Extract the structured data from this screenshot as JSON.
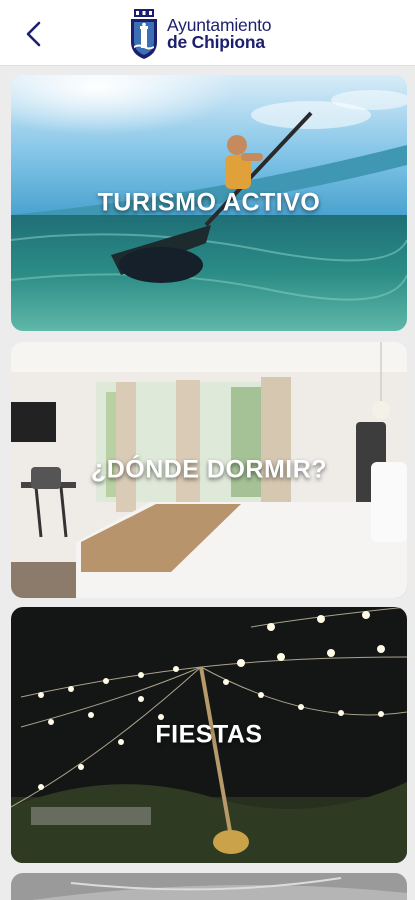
{
  "header": {
    "title_line1": "Ayuntamiento",
    "title_line2": "de Chipiona",
    "back_icon": "chevron-left-icon",
    "crest_icon": "municipal-crest-icon"
  },
  "cards": [
    {
      "title": "TURISMO ACTIVO"
    },
    {
      "title": "¿DÓNDE DORMIR?"
    },
    {
      "title": "FIESTAS"
    },
    {
      "title": ""
    }
  ],
  "colors": {
    "brand": "#1c1f6e",
    "header_bg": "#ffffff",
    "page_bg": "#ececec"
  }
}
